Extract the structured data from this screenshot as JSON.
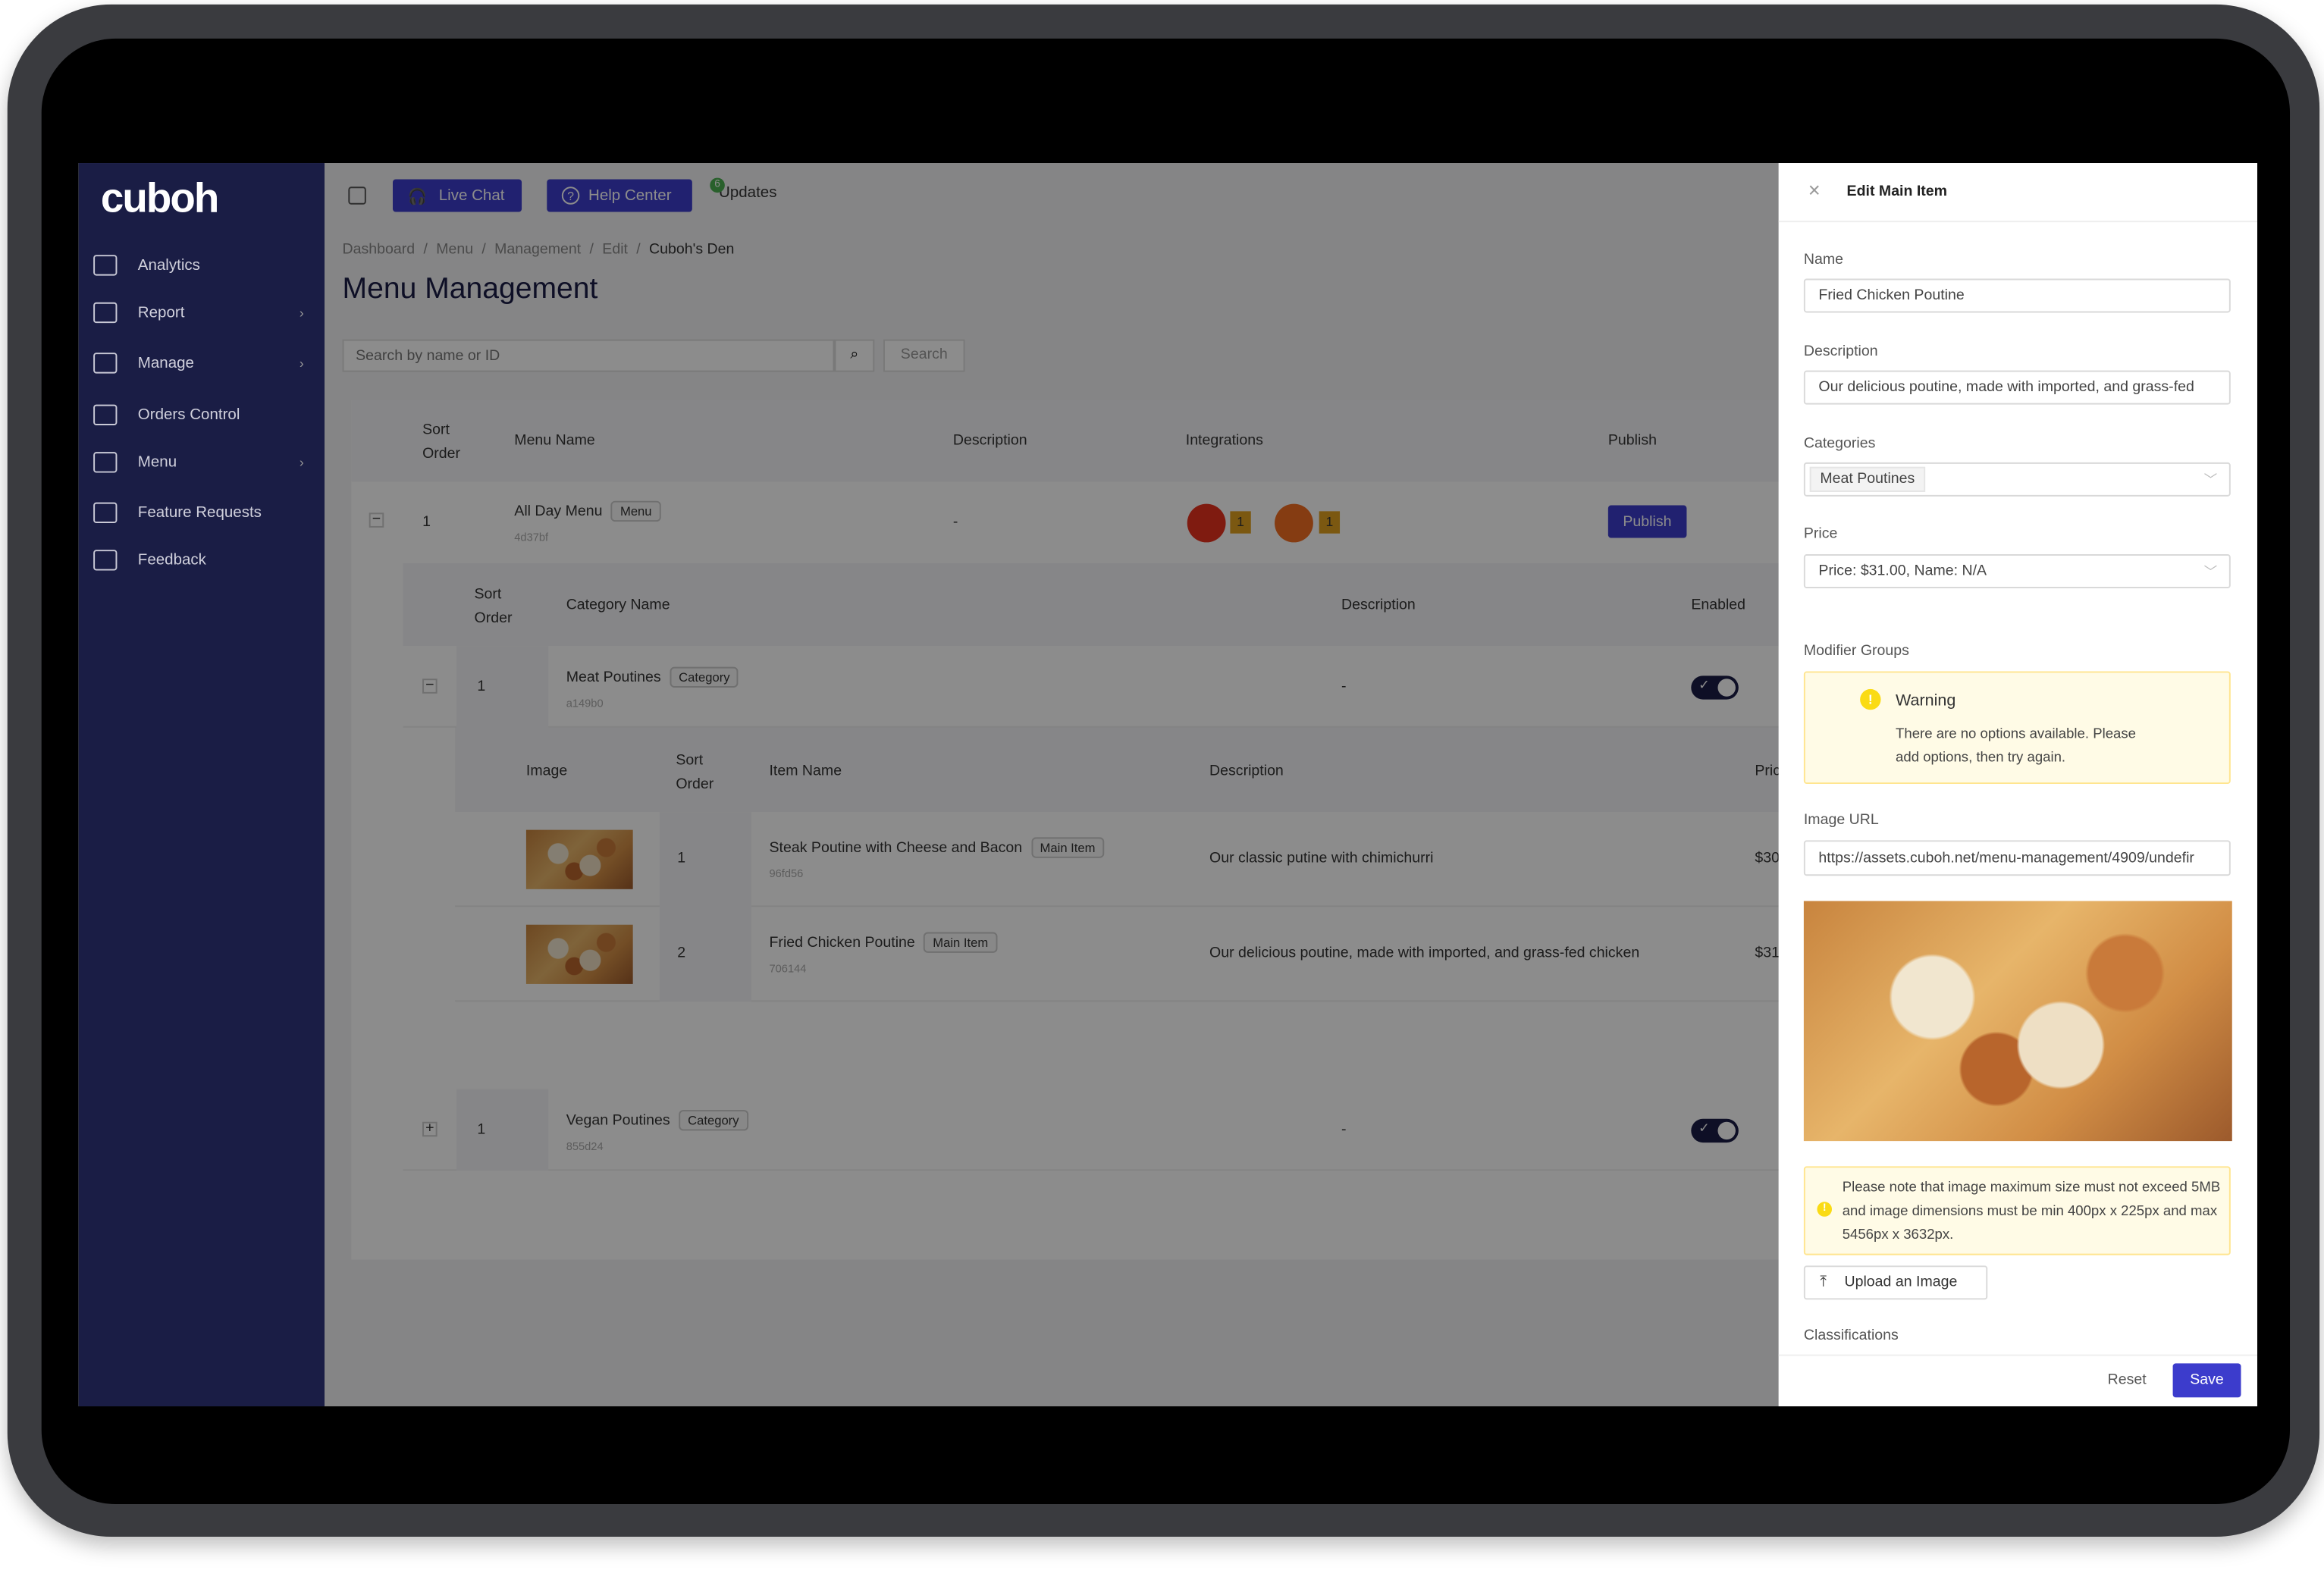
{
  "sidebar": {
    "logo": "cuboh",
    "items": [
      {
        "label": "Analytics",
        "icon": "trend-icon",
        "chevron": false
      },
      {
        "label": "Report",
        "icon": "book-icon",
        "chevron": true
      },
      {
        "label": "Manage",
        "icon": "wrench-icon",
        "chevron": true
      },
      {
        "label": "Orders Control",
        "icon": "grid-icon",
        "chevron": false
      },
      {
        "label": "Menu",
        "icon": "map-icon",
        "chevron": true
      },
      {
        "label": "Feature Requests",
        "icon": "clipboard-icon",
        "chevron": false
      },
      {
        "label": "Feedback",
        "icon": "thumbs-up-icon",
        "chevron": false
      }
    ]
  },
  "topbar": {
    "live_chat": "Live Chat",
    "help_center": "Help Center",
    "updates": "Updates",
    "updates_badge": "6"
  },
  "breadcrumb": [
    "Dashboard",
    "Menu",
    "Management",
    "Edit",
    "Cuboh's Den"
  ],
  "page_title": "Menu Management",
  "search": {
    "placeholder": "Search by name or ID",
    "button": "Search"
  },
  "menu_table": {
    "headers": {
      "sort": "Sort Order",
      "name": "Menu Name",
      "description": "Description",
      "integrations": "Integrations",
      "publish": "Publish"
    },
    "row": {
      "sort": "1",
      "name": "All Day Menu",
      "tag": "Menu",
      "id": "4d37bf",
      "description": "-",
      "integrations": [
        {
          "name": "doordash",
          "count": "1",
          "color": "#e8321e"
        },
        {
          "name": "skip",
          "count": "1",
          "color": "#f36d21"
        }
      ],
      "publish": "Publish"
    }
  },
  "category_table": {
    "headers": {
      "sort": "Sort Order",
      "name": "Category Name",
      "description": "Description",
      "enabled": "Enabled"
    },
    "rows": [
      {
        "expand": "−",
        "sort": "1",
        "name": "Meat Poutines",
        "tag": "Category",
        "id": "a149b0",
        "description": "-",
        "enabled": true
      },
      {
        "expand": "+",
        "sort": "1",
        "name": "Vegan Poutines",
        "tag": "Category",
        "id": "855d24",
        "description": "-",
        "enabled": true
      }
    ]
  },
  "item_table": {
    "headers": {
      "image": "Image",
      "sort": "Sort Order",
      "name": "Item Name",
      "description": "Description",
      "price": "Pric"
    },
    "rows": [
      {
        "sort": "1",
        "name": "Steak Poutine with Cheese and Bacon",
        "tag": "Main Item",
        "id": "96fd56",
        "description": "Our classic putine with chimichurri",
        "price": "$30"
      },
      {
        "sort": "2",
        "name": "Fried Chicken Poutine",
        "tag": "Main Item",
        "id": "706144",
        "description": "Our delicious poutine, made with imported, and grass-fed chicken",
        "price": "$31"
      }
    ]
  },
  "drawer": {
    "title": "Edit Main Item",
    "name_label": "Name",
    "name_value": "Fried Chicken Poutine",
    "description_label": "Description",
    "description_value": "Our delicious poutine, made with imported, and grass-fed",
    "categories_label": "Categories",
    "category_tag": "Meat Poutines",
    "price_label": "Price",
    "price_value": "Price: $31.00, Name: N/A",
    "modifier_label": "Modifier Groups",
    "warning_title": "Warning",
    "warning_text": "There are no options available. Please add options, then try again.",
    "image_url_label": "Image URL",
    "image_url_value": "https://assets.cuboh.net/menu-management/4909/undefir",
    "image_note": "Please note that image maximum size must not exceed 5MB and image dimensions must be min 400px x 225px and max 5456px x 3632px.",
    "upload": "Upload an Image",
    "classifications_label": "Classifications",
    "reset": "Reset",
    "save": "Save"
  },
  "colors": {
    "sidebar": "#1a1d45",
    "accent": "#3c3ccc",
    "warning_bg": "#fffbe6",
    "warning_icon": "#fadb14"
  }
}
